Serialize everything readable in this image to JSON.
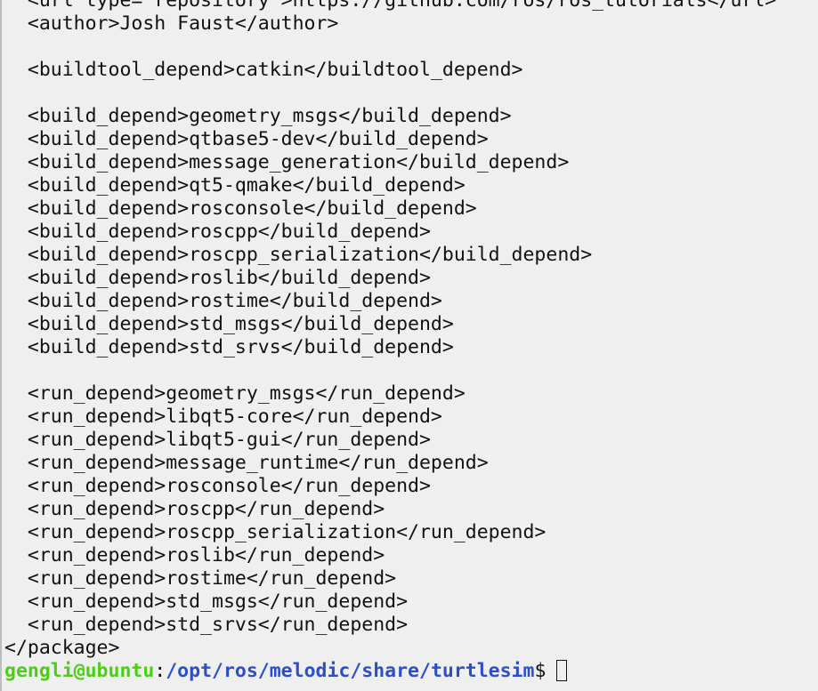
{
  "terminal": {
    "lines": [
      "  <url type=\"repository\">https://github.com/ros/ros_tutorials</url>",
      "  <author>Josh Faust</author>",
      "",
      "  <buildtool_depend>catkin</buildtool_depend>",
      "",
      "  <build_depend>geometry_msgs</build_depend>",
      "  <build_depend>qtbase5-dev</build_depend>",
      "  <build_depend>message_generation</build_depend>",
      "  <build_depend>qt5-qmake</build_depend>",
      "  <build_depend>rosconsole</build_depend>",
      "  <build_depend>roscpp</build_depend>",
      "  <build_depend>roscpp_serialization</build_depend>",
      "  <build_depend>roslib</build_depend>",
      "  <build_depend>rostime</build_depend>",
      "  <build_depend>std_msgs</build_depend>",
      "  <build_depend>std_srvs</build_depend>",
      "",
      "  <run_depend>geometry_msgs</run_depend>",
      "  <run_depend>libqt5-core</run_depend>",
      "  <run_depend>libqt5-gui</run_depend>",
      "  <run_depend>message_runtime</run_depend>",
      "  <run_depend>rosconsole</run_depend>",
      "  <run_depend>roscpp</run_depend>",
      "  <run_depend>roscpp_serialization</run_depend>",
      "  <run_depend>roslib</run_depend>",
      "  <run_depend>rostime</run_depend>",
      "  <run_depend>std_msgs</run_depend>",
      "  <run_depend>std_srvs</run_depend>",
      "</package>"
    ],
    "prompt": {
      "user_host": "gengli@ubuntu",
      "separator": ":",
      "path": "/opt/ros/melodic/share/turtlesim",
      "symbol": "$"
    },
    "colors": {
      "background": "#efefef",
      "text": "#111111",
      "prompt_user": "#4ad012",
      "prompt_path": "#2d4ec9"
    }
  }
}
